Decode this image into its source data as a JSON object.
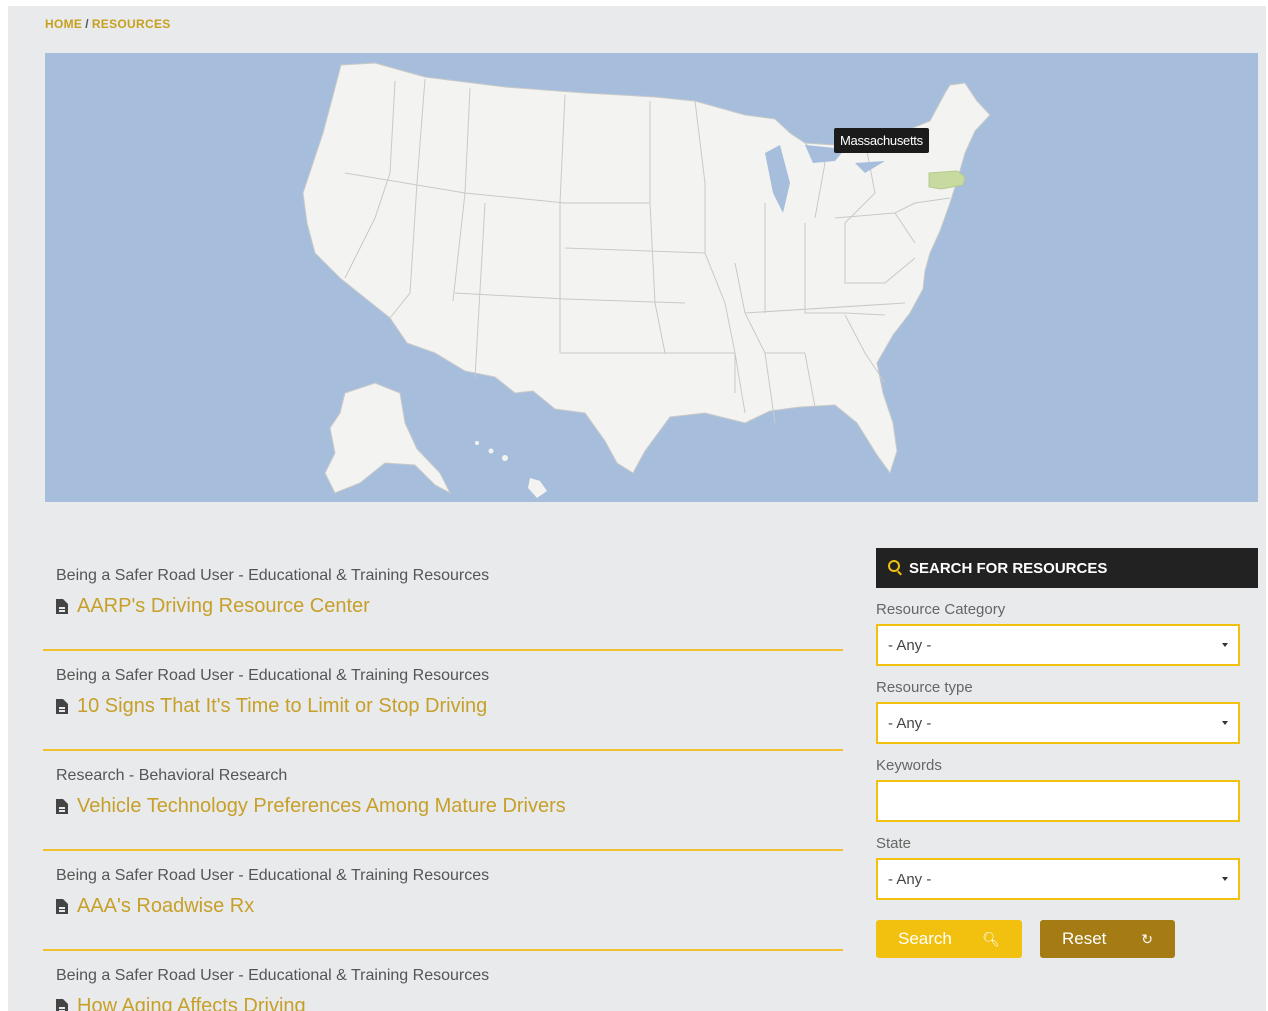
{
  "breadcrumb": {
    "home": "HOME",
    "separator": "/",
    "current": "RESOURCES"
  },
  "map": {
    "tooltip": "Massachusetts",
    "highlighted_state": "Massachusetts",
    "highlight_color": "#c7dba0"
  },
  "results": [
    {
      "category": "Being a Safer Road User - Educational & Training Resources",
      "title": "AARP's Driving Resource Center"
    },
    {
      "category": "Being a Safer Road User - Educational & Training Resources",
      "title": "10 Signs That It's Time to Limit or Stop Driving"
    },
    {
      "category": "Research - Behavioral Research",
      "title": "Vehicle Technology Preferences Among Mature Drivers"
    },
    {
      "category": "Being a Safer Road User - Educational & Training Resources",
      "title": "AAA's Roadwise Rx"
    },
    {
      "category": "Being a Safer Road User - Educational & Training Resources",
      "title": "How Aging Affects Driving"
    }
  ],
  "sidebar": {
    "heading": "SEARCH FOR RESOURCES",
    "category_label": "Resource Category",
    "category_value": "- Any -",
    "type_label": "Resource type",
    "type_value": "- Any -",
    "keywords_label": "Keywords",
    "keywords_value": "",
    "state_label": "State",
    "state_value": "- Any -",
    "search_button": "Search",
    "reset_button": "Reset"
  },
  "colors": {
    "accent": "#f2c10f",
    "link": "#c7a02a",
    "reset": "#a57c14",
    "map_water": "#a6bedc"
  }
}
